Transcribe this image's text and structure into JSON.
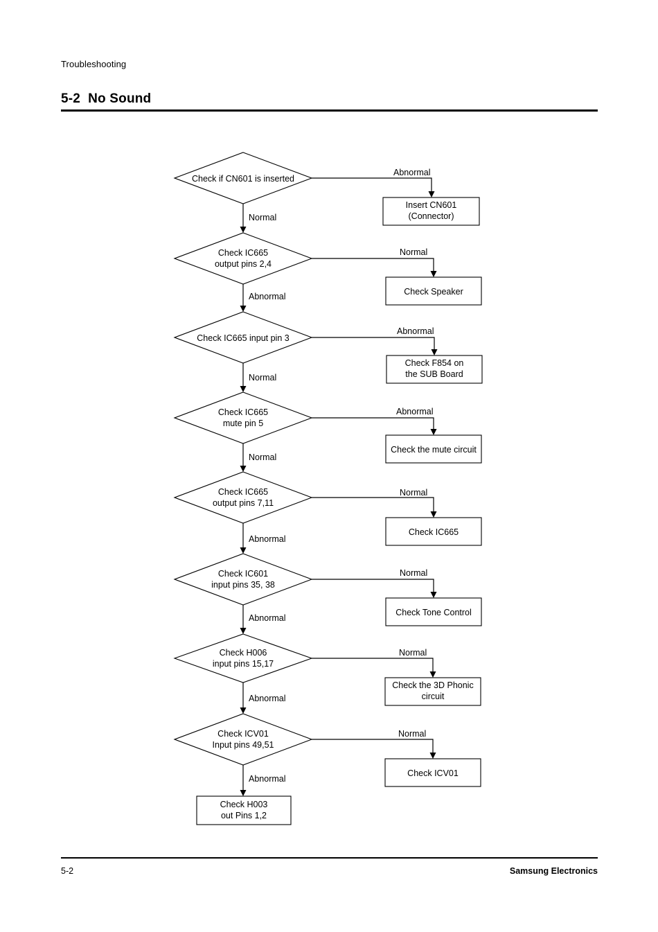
{
  "header": {
    "running_head": "Troubleshooting",
    "section_number": "5-2",
    "section_title": "No Sound"
  },
  "footer": {
    "page_number": "5-2",
    "company": "Samsung Electronics"
  },
  "flowchart": {
    "title": "No Sound troubleshooting flow",
    "decisions": [
      {
        "id": "d1",
        "lines": [
          "Check if CN601 is inserted"
        ],
        "down_label": "Normal",
        "right_label": "Abnormal"
      },
      {
        "id": "d2",
        "lines": [
          "Check IC665",
          "output pins 2,4"
        ],
        "down_label": "Abnormal",
        "right_label": "Normal"
      },
      {
        "id": "d3",
        "lines": [
          "Check IC665 input pin 3"
        ],
        "down_label": "Normal",
        "right_label": "Abnormal"
      },
      {
        "id": "d4",
        "lines": [
          "Check IC665",
          "mute pin 5"
        ],
        "down_label": "Normal",
        "right_label": "Abnormal"
      },
      {
        "id": "d5",
        "lines": [
          "Check IC665",
          "output pins 7,11"
        ],
        "down_label": "Abnormal",
        "right_label": "Normal"
      },
      {
        "id": "d6",
        "lines": [
          "Check IC601",
          "input pins 35, 38"
        ],
        "down_label": "Abnormal",
        "right_label": "Normal"
      },
      {
        "id": "d7",
        "lines": [
          "Check H006",
          "input pins 15,17"
        ],
        "down_label": "Abnormal",
        "right_label": "Normal"
      },
      {
        "id": "d8",
        "lines": [
          "Check ICV01",
          "Input pins 49,51"
        ],
        "down_label": "Abnormal",
        "right_label": "Normal"
      }
    ],
    "result_boxes": [
      {
        "id": "b1",
        "lines": [
          "Insert CN601",
          "(Connector)"
        ]
      },
      {
        "id": "b2",
        "lines": [
          "Check Speaker"
        ]
      },
      {
        "id": "b3",
        "lines": [
          "Check F854 on",
          "the SUB Board"
        ]
      },
      {
        "id": "b4",
        "lines": [
          "Check the mute circuit"
        ]
      },
      {
        "id": "b5",
        "lines": [
          "Check IC665"
        ]
      },
      {
        "id": "b6",
        "lines": [
          "Check Tone Control"
        ]
      },
      {
        "id": "b7",
        "lines": [
          "Check the 3D Phonic",
          "circuit"
        ]
      },
      {
        "id": "b8",
        "lines": [
          "Check ICV01"
        ]
      }
    ],
    "terminal_box": {
      "id": "b9",
      "lines": [
        "Check H003",
        "out Pins 1,2"
      ]
    }
  }
}
